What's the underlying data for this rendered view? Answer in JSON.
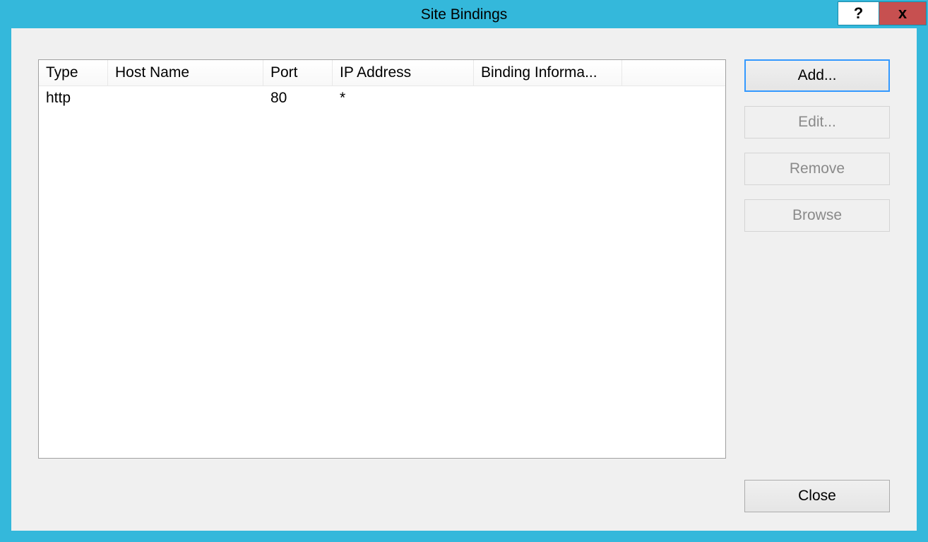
{
  "window": {
    "title": "Site Bindings",
    "help_symbol": "?",
    "close_symbol": "x"
  },
  "table": {
    "columns": {
      "type": "Type",
      "hostname": "Host Name",
      "port": "Port",
      "ipaddress": "IP Address",
      "bindinginfo": "Binding Informa..."
    },
    "rows": [
      {
        "type": "http",
        "hostname": "",
        "port": "80",
        "ipaddress": "*",
        "bindinginfo": ""
      }
    ]
  },
  "buttons": {
    "add": "Add...",
    "edit": "Edit...",
    "remove": "Remove",
    "browse": "Browse",
    "close": "Close"
  }
}
